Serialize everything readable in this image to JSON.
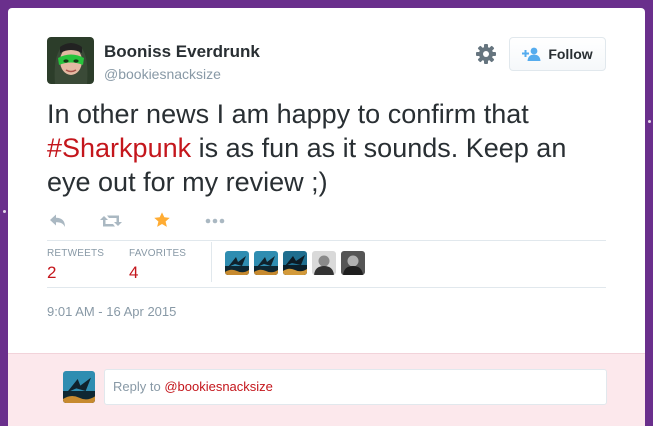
{
  "user": {
    "name": "Booniss Everdrunk",
    "handle": "@bookiesnacksize"
  },
  "header": {
    "follow_label": "Follow",
    "settings_icon": "gear-icon",
    "follow_icon": "add-user-icon"
  },
  "tweet": {
    "text_before": "In other news I am happy to confirm that ",
    "hashtag": "#Sharkpunk",
    "text_after": " is as fun as it sounds. Keep an eye out for my review ;)"
  },
  "actions": [
    {
      "name": "reply",
      "icon": "reply-icon"
    },
    {
      "name": "retweet",
      "icon": "retweet-icon"
    },
    {
      "name": "favorite",
      "icon": "star-icon",
      "active": true
    },
    {
      "name": "more",
      "icon": "more-icon"
    }
  ],
  "stats": {
    "retweets_label": "RETWEETS",
    "retweets_count": "2",
    "favorites_label": "FAVORITES",
    "favorites_count": "4"
  },
  "timestamp": "9:01 AM - 16 Apr 2015",
  "reply": {
    "prefix": "Reply to ",
    "handle": "@bookiesnacksize"
  },
  "colors": {
    "page_background": "#6a2f8c",
    "hashtag": "#c4161c",
    "star_active": "#ffac33",
    "reply_background": "#fce8ec"
  }
}
